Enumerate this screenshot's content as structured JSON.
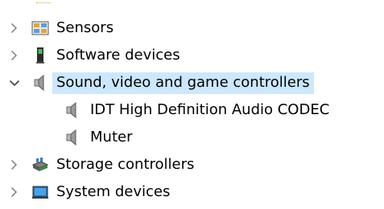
{
  "tree": {
    "items": [
      {
        "label": "Sensors",
        "expanded": false,
        "icon": "sensors-icon"
      },
      {
        "label": "Software devices",
        "expanded": false,
        "icon": "software-device-icon"
      },
      {
        "label": "Sound, video and game controllers",
        "expanded": true,
        "selected": true,
        "icon": "speaker-icon",
        "children": [
          {
            "label": "IDT High Definition Audio CODEC",
            "icon": "speaker-icon"
          },
          {
            "label": "Muter",
            "icon": "speaker-icon"
          }
        ]
      },
      {
        "label": "Storage controllers",
        "expanded": false,
        "icon": "storage-controller-icon"
      },
      {
        "label": "System devices",
        "expanded": false,
        "icon": "system-devices-icon"
      }
    ]
  },
  "colors": {
    "selection_bg": "#cce8ff",
    "chevron": "#808080",
    "text": "#000000"
  }
}
